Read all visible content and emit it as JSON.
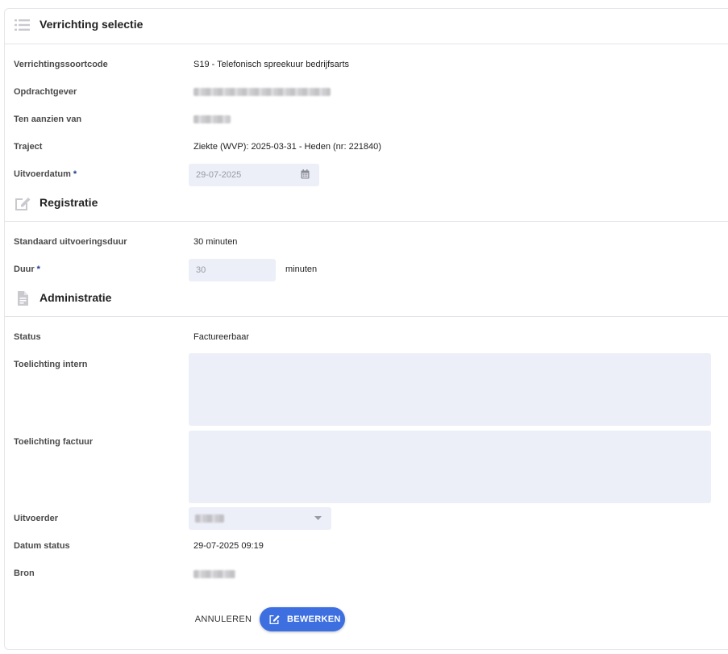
{
  "sections": {
    "selection": {
      "title": "Verrichting selectie",
      "icon": "list-icon"
    },
    "registration": {
      "title": "Registratie",
      "icon": "edit-icon"
    },
    "administration": {
      "title": "Administratie",
      "icon": "document-icon"
    }
  },
  "selection": {
    "code_label": "Verrichtingssoortcode",
    "code_value": "S19 - Telefonisch spreekuur bedrijfsarts",
    "client_label": "Opdrachtgever",
    "concerning_label": "Ten aanzien van",
    "trajectory_label": "Traject",
    "trajectory_value": "Ziekte (WVP): 2025-03-31 - Heden (nr: 221840)",
    "execution_date_label": "Uitvoerdatum",
    "execution_date_value": "29-07-2025",
    "required_marker": "*"
  },
  "registration": {
    "standard_duration_label": "Standaard uitvoeringsduur",
    "standard_duration_value": "30 minuten",
    "duration_label": "Duur",
    "duration_placeholder": "30",
    "duration_unit": "minuten",
    "required_marker": "*"
  },
  "administration": {
    "status_label": "Status",
    "status_value": "Factureerbaar",
    "internal_note_label": "Toelichting intern",
    "invoice_note_label": "Toelichting factuur",
    "executor_label": "Uitvoerder",
    "status_date_label": "Datum status",
    "status_date_value": "29-07-2025 09:19",
    "source_label": "Bron"
  },
  "actions": {
    "cancel_label": "ANNULEREN",
    "edit_label": "BEWERKEN"
  },
  "colors": {
    "primary": "#3d6fe0",
    "field_bg": "#eceef8",
    "required": "#1e3a8a"
  }
}
